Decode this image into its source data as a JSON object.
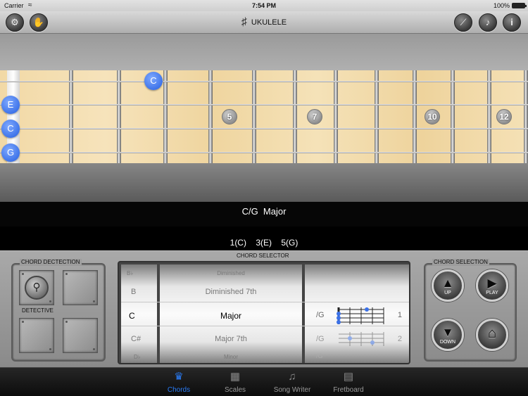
{
  "status_bar": {
    "carrier": "Carrier",
    "time": "7:54 PM",
    "battery": "100%"
  },
  "toolbar": {
    "title": "UKULELE",
    "left_buttons": [
      "gears-icon",
      "hand-icon"
    ],
    "right_buttons": [
      "tuning-fork-icon",
      "music-note-icon",
      "info-icon"
    ]
  },
  "fretboard": {
    "open_strings": [
      "E",
      "C",
      "G"
    ],
    "fret_markers": [
      "5",
      "7",
      "10",
      "12"
    ],
    "fretted_notes": [
      {
        "label": "C"
      }
    ]
  },
  "chord_display": {
    "chord": "C/G",
    "quality": "Major"
  },
  "intervals": [
    "1(C)",
    "3(E)",
    "5(G)"
  ],
  "panel": {
    "detection_label": "CHORD DECTECTION",
    "detective_label": "DETECTIVE",
    "selector_label": "CHORD SELECTOR",
    "selection_label": "CHORD SELECTION",
    "roots": [
      "B♭",
      "B",
      "C",
      "C#",
      "D♭"
    ],
    "qualities": [
      "Diminished",
      "Diminished 7th",
      "Major",
      "Major 7th",
      "Minor"
    ],
    "voicings": [
      {
        "bass": "/G",
        "fret_number": "1"
      },
      {
        "bass": "/G",
        "fret_number": "2"
      },
      {
        "bass": "/G",
        "fret_number": ""
      }
    ],
    "buttons": {
      "up": "UP",
      "play": "PLAY",
      "down": "DOWN"
    }
  },
  "tabs": [
    {
      "label": "Chords",
      "icon": "guitar-pick-icon",
      "active": true
    },
    {
      "label": "Scales",
      "icon": "scale-grid-icon",
      "active": false
    },
    {
      "label": "Song Writer",
      "icon": "treble-clef-icon",
      "active": false
    },
    {
      "label": "Fretboard",
      "icon": "fretboard-icon",
      "active": false
    }
  ],
  "colors": {
    "accent": "#2a7cf6",
    "note_blue": "#3b71e8"
  }
}
